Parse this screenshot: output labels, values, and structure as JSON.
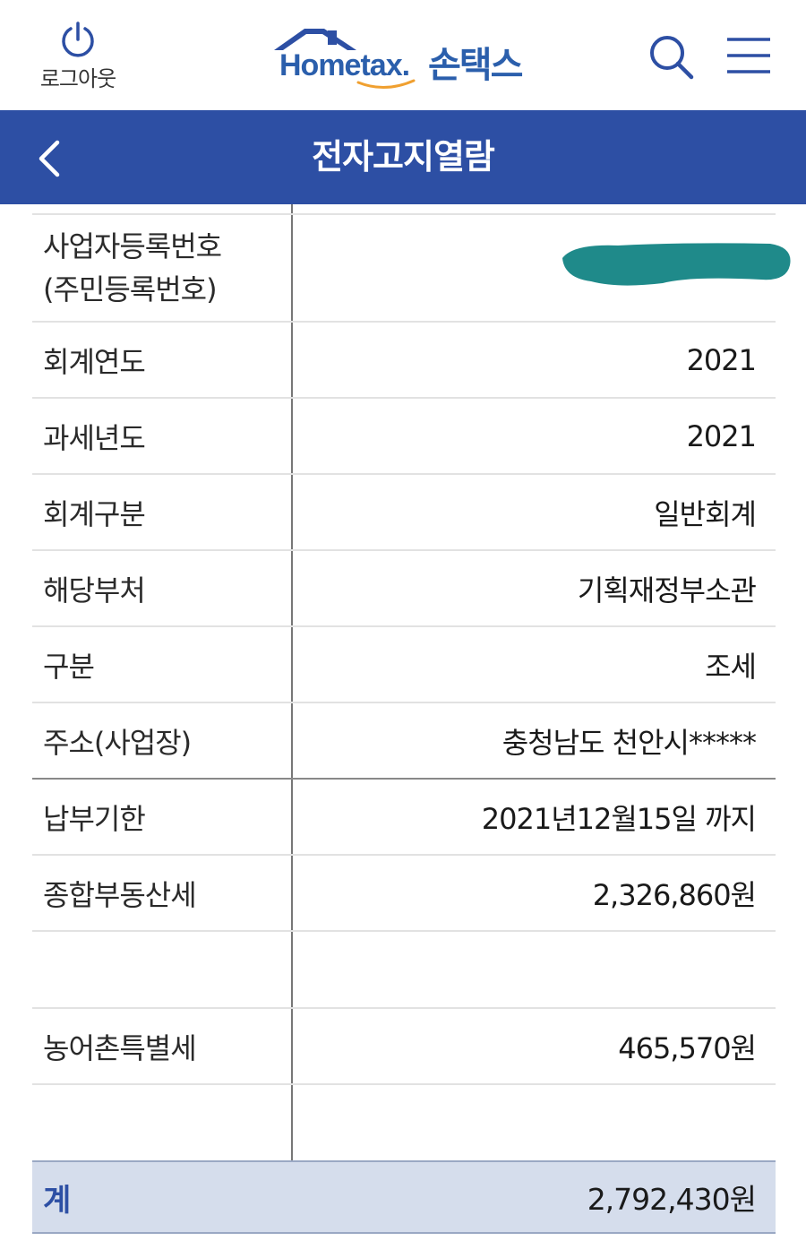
{
  "header": {
    "logout_label": "로그아웃",
    "logo_text": "Hometax.",
    "logo_korean": "손택스"
  },
  "titlebar": {
    "title": "전자고지열람"
  },
  "details": {
    "business_reg_label_line1": "사업자등록번호",
    "business_reg_label_line2": "(주민등록번호)",
    "rows": [
      {
        "label": "회계연도",
        "value": "2021"
      },
      {
        "label": "과세년도",
        "value": "2021"
      },
      {
        "label": "회계구분",
        "value": "일반회계"
      },
      {
        "label": "해당부처",
        "value": "기획재정부소관"
      },
      {
        "label": "구분",
        "value": "조세"
      },
      {
        "label": "주소(사업장)",
        "value": "충청남도 천안시*****"
      },
      {
        "label": "납부기한",
        "value": "2021년12월15일 까지"
      },
      {
        "label": "종합부동산세",
        "value": "2,326,860원"
      },
      {
        "label": "농어촌특별세",
        "value": "465,570원"
      }
    ],
    "total_label": "계",
    "total_value": "2,792,430원"
  },
  "colors": {
    "brand_blue": "#2d4fa4",
    "total_row_bg": "#d5ddec",
    "redaction": "#1f8a8a",
    "logo_orange": "#f0a030"
  }
}
